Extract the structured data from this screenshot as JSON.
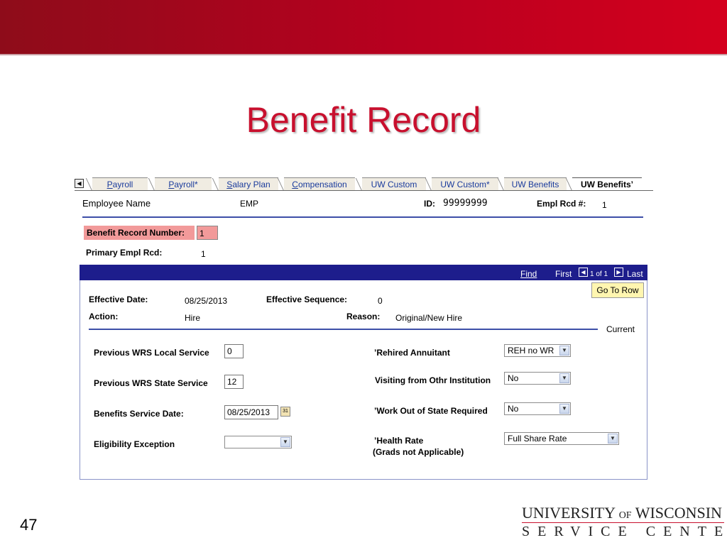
{
  "slide": {
    "title": "Benefit Record",
    "number": "47",
    "logo_line1_a": "UNIVERSITY",
    "logo_line1_of": "OF",
    "logo_line1_b": "WISCONSIN",
    "logo_line2": "SERVICE CENTER",
    "accent_color": "#c8102e"
  },
  "tabs": [
    {
      "label": "Payroll",
      "mnemonic": "P",
      "rest": "ayroll"
    },
    {
      "label": "Payroll*",
      "mnemonic": "P",
      "rest": "ayroll*"
    },
    {
      "label": "Salary Plan",
      "mnemonic": "S",
      "rest": "alary Plan"
    },
    {
      "label": "Compensation",
      "mnemonic": "C",
      "rest": "ompensation"
    },
    {
      "label": "UW Custom"
    },
    {
      "label": "UW Custom*"
    },
    {
      "label": "UW Benefits"
    },
    {
      "label": "UW Benefits’",
      "active": true
    }
  ],
  "header": {
    "employee_name_label": "Employee Name",
    "employee_name_value": "EMP",
    "id_label": "ID:",
    "id_value": "99999999",
    "empl_rcd_label": "Empl Rcd #:",
    "empl_rcd_value": "1"
  },
  "benefit_record": {
    "number_label": "Benefit Record Number:",
    "number_value": "1",
    "primary_label": "Primary Empl Rcd:",
    "primary_value": "1"
  },
  "nav": {
    "find": "Find",
    "first": "First",
    "count": "1 of 1",
    "last": "Last",
    "go_to_row": "Go To Row"
  },
  "effective": {
    "date_label": "Effective Date:",
    "date_value": "08/25/2013",
    "seq_label": "Effective Sequence:",
    "seq_value": "0",
    "action_label": "Action:",
    "action_value": "Hire",
    "reason_label": "Reason:",
    "reason_value": "Original/New Hire",
    "current": "Current"
  },
  "form": {
    "local_service_label": "Previous WRS Local Service",
    "local_service_value": "0",
    "state_service_label": "Previous WRS State Service",
    "state_service_value": "12",
    "service_date_label": "Benefits Service Date:",
    "service_date_value": "08/25/2013",
    "eligibility_label": "Eligibility Exception",
    "eligibility_value": "",
    "rehired_label": "’Rehired Annuitant",
    "rehired_value": "REH no WR",
    "visiting_label": "Visiting from Othr Institution",
    "visiting_value": "No",
    "out_of_state_label": "’Work Out of State Required",
    "out_of_state_value": "No",
    "health_rate_label": "’Health Rate",
    "health_rate_sub": "(Grads not Applicable)",
    "health_rate_value": "Full Share Rate"
  }
}
